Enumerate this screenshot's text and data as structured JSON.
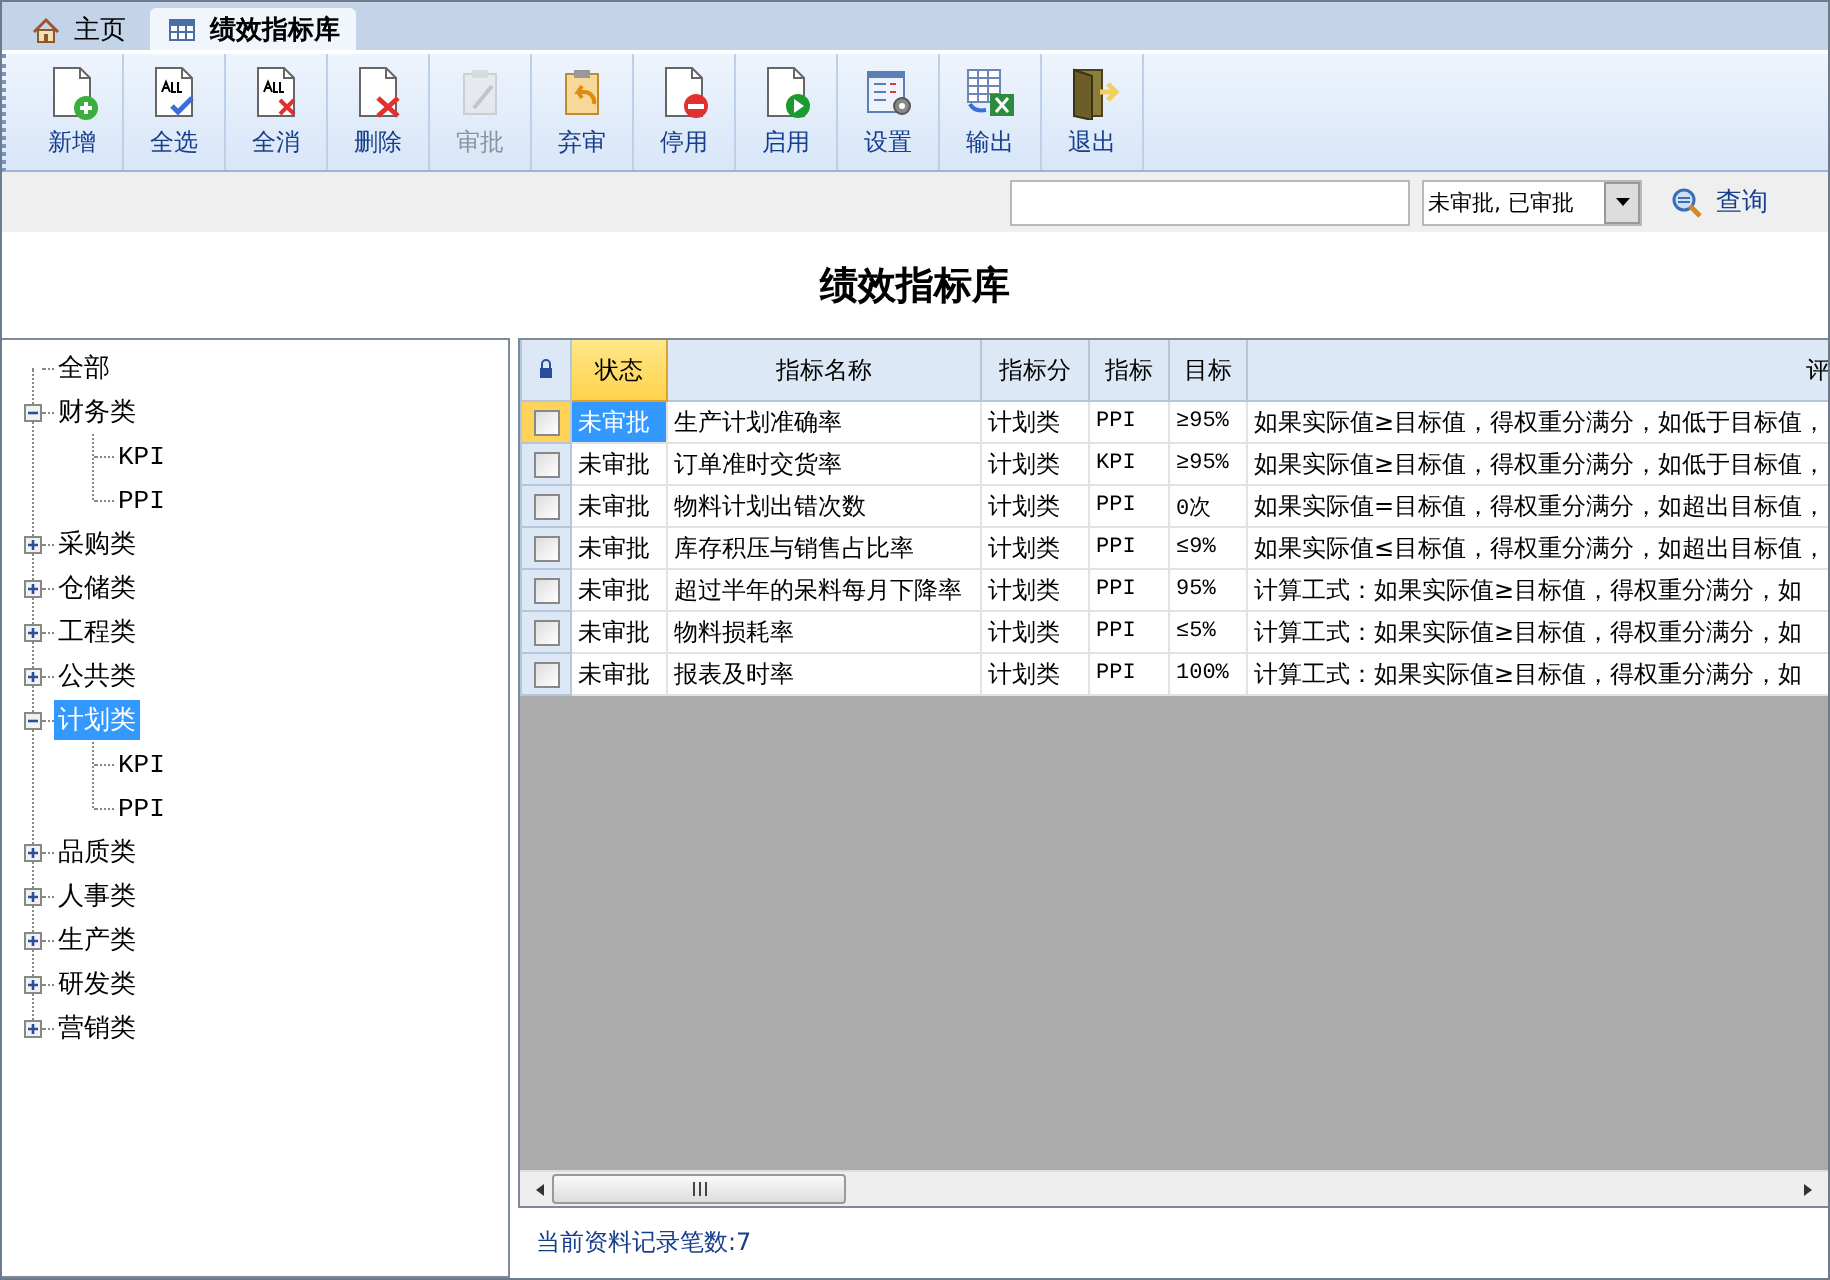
{
  "tabs": [
    {
      "label": "主页",
      "selected": false
    },
    {
      "label": "绩效指标库",
      "selected": true
    }
  ],
  "toolbar": [
    {
      "label": "新增",
      "disabled": false
    },
    {
      "label": "全选",
      "disabled": false
    },
    {
      "label": "全消",
      "disabled": false
    },
    {
      "label": "删除",
      "disabled": false
    },
    {
      "label": "审批",
      "disabled": true
    },
    {
      "label": "弃审",
      "disabled": false
    },
    {
      "label": "停用",
      "disabled": false
    },
    {
      "label": "启用",
      "disabled": false
    },
    {
      "label": "设置",
      "disabled": false
    },
    {
      "label": "输出",
      "disabled": false
    },
    {
      "label": "退出",
      "disabled": false
    }
  ],
  "search": {
    "dropdown_value": "未审批, 已审批",
    "query_button": "查询"
  },
  "page_title": "绩效指标库",
  "tree": [
    {
      "label": "全部",
      "selected": false
    },
    {
      "label": "财务类",
      "expanded": true,
      "selected": false,
      "children": [
        {
          "label": "KPI",
          "selected": false
        },
        {
          "label": "PPI",
          "selected": false
        }
      ]
    },
    {
      "label": "采购类",
      "expanded": false,
      "selected": false
    },
    {
      "label": "仓储类",
      "expanded": false,
      "selected": false
    },
    {
      "label": "工程类",
      "expanded": false,
      "selected": false
    },
    {
      "label": "公共类",
      "expanded": false,
      "selected": false
    },
    {
      "label": "计划类",
      "expanded": true,
      "selected": true,
      "children": [
        {
          "label": "KPI",
          "selected": false
        },
        {
          "label": "PPI",
          "selected": false
        }
      ]
    },
    {
      "label": "品质类",
      "expanded": false,
      "selected": false
    },
    {
      "label": "人事类",
      "expanded": false,
      "selected": false
    },
    {
      "label": "生产类",
      "expanded": false,
      "selected": false
    },
    {
      "label": "研发类",
      "expanded": false,
      "selected": false
    },
    {
      "label": "营销类",
      "expanded": false,
      "selected": false
    }
  ],
  "table": {
    "columns": [
      {
        "label": "状态",
        "selected": true
      },
      {
        "label": "指标名称",
        "selected": false
      },
      {
        "label": "指标分",
        "selected": false
      },
      {
        "label": "指标",
        "selected": false
      },
      {
        "label": "目标",
        "selected": false
      },
      {
        "label": "评",
        "selected": false
      }
    ],
    "rows": [
      {
        "checked": false,
        "selected": true,
        "cells": [
          "未审批",
          "生产计划准确率",
          "计划类",
          "PPI",
          "≥95%",
          "如果实际值≥目标值，得权重分满分，如低于目标值，"
        ]
      },
      {
        "checked": false,
        "selected": false,
        "cells": [
          "未审批",
          "订单准时交货率",
          "计划类",
          "KPI",
          "≥95%",
          "如果实际值≥目标值，得权重分满分，如低于目标值，"
        ]
      },
      {
        "checked": false,
        "selected": false,
        "cells": [
          "未审批",
          "物料计划出错次数",
          "计划类",
          "PPI",
          "0次",
          "如果实际值=目标值，得权重分满分，如超出目标值，"
        ]
      },
      {
        "checked": false,
        "selected": false,
        "cells": [
          "未审批",
          "库存积压与销售占比率",
          "计划类",
          "PPI",
          "≤9%",
          "如果实际值≤目标值，得权重分满分，如超出目标值，"
        ]
      },
      {
        "checked": false,
        "selected": false,
        "cells": [
          "未审批",
          "超过半年的呆料每月下降率",
          "计划类",
          "PPI",
          "95%",
          "计算工式：如果实际值≥目标值，得权重分满分，如"
        ]
      },
      {
        "checked": false,
        "selected": false,
        "cells": [
          "未审批",
          "物料损耗率",
          "计划类",
          "PPI",
          "≤5%",
          "计算工式：如果实际值≥目标值，得权重分满分，如"
        ]
      },
      {
        "checked": false,
        "selected": false,
        "cells": [
          "未审批",
          "报表及时率",
          "计划类",
          "PPI",
          "100%",
          "计算工式：如果实际值≥目标值，得权重分满分，如"
        ]
      }
    ]
  },
  "footer": "当前资料记录笔数:7"
}
